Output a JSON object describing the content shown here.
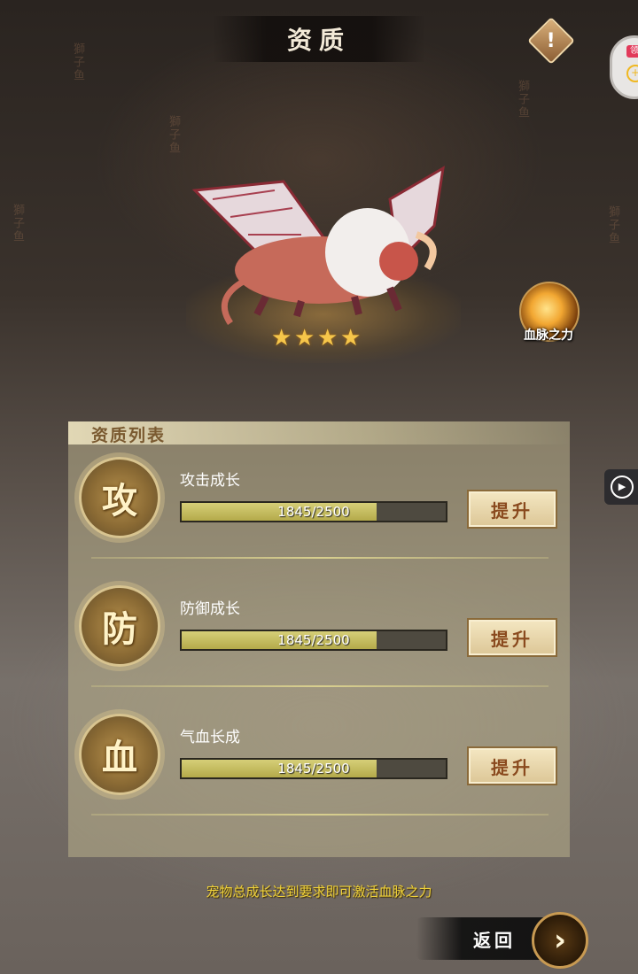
{
  "header": {
    "title": "资质"
  },
  "pet": {
    "stars": 4
  },
  "bloodline": {
    "label": "血脉之力"
  },
  "side_widget": {
    "tag": "领"
  },
  "panel": {
    "title": "资质列表",
    "stats": [
      {
        "emblem": "攻",
        "label": "攻击成长",
        "current": 1845,
        "max": 2500,
        "value_text": "1845/2500",
        "button": "提升"
      },
      {
        "emblem": "防",
        "label": "防御成长",
        "current": 1845,
        "max": 2500,
        "value_text": "1845/2500",
        "button": "提升"
      },
      {
        "emblem": "血",
        "label": "气血长成",
        "current": 1845,
        "max": 2500,
        "value_text": "1845/2500",
        "button": "提升"
      }
    ]
  },
  "footer": {
    "note": "宠物总成长达到要求即可激活血脉之力",
    "back_label": "返回"
  },
  "colors": {
    "accent": "#f0d23a",
    "bar_fill": "#c4bc5a",
    "button_text": "#8a4a1e"
  }
}
